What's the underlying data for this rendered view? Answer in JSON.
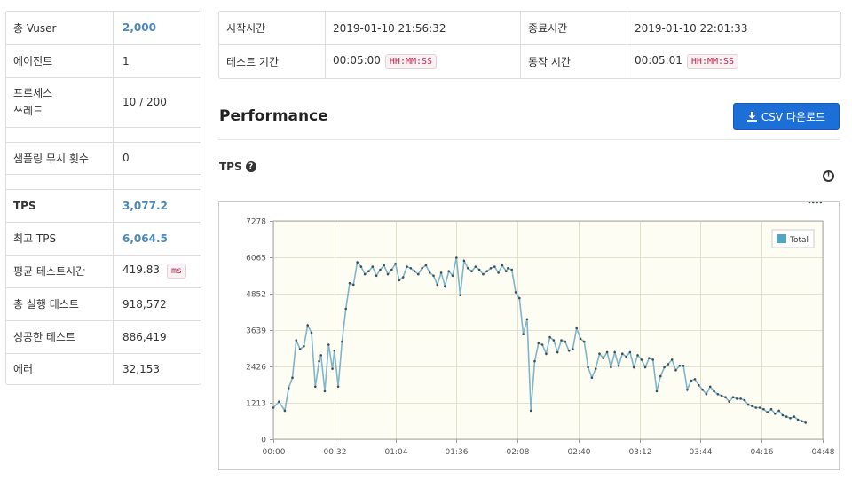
{
  "summary": {
    "rows": [
      {
        "label": "총 Vuser",
        "value": "2,000"
      },
      {
        "label": "에이전트",
        "value": "1"
      },
      {
        "label": "프로세스\n쓰레드",
        "value": "10 / 200"
      },
      {
        "label": "샘플링 무시 횟수",
        "value": "0"
      },
      {
        "label": "TPS",
        "value": "3,077.2"
      },
      {
        "label": "최고 TPS",
        "value": "6,064.5"
      },
      {
        "label": "평균 테스트시간",
        "value": "419.83",
        "unit": "ms"
      },
      {
        "label": "총 실행 테스트",
        "value": "918,572"
      },
      {
        "label": "성공한 테스트",
        "value": "886,419"
      },
      {
        "label": "에러",
        "value": "32,153"
      }
    ]
  },
  "timing": {
    "start_label": "시작시간",
    "start_value": "2019-01-10 21:56:32",
    "end_label": "종료시간",
    "end_value": "2019-01-10 22:01:33",
    "duration_label": "테스트 기간",
    "duration_value": "00:05:00",
    "duration_format": "HH:MM:SS",
    "run_label": "동작 시간",
    "run_value": "00:05:01",
    "run_format": "HH:MM:SS"
  },
  "performance": {
    "title": "Performance",
    "csv_button": "CSV 다운로드",
    "tps_label": "TPS"
  },
  "colors": {
    "accent": "#4c87b9",
    "button": "#1c6fd6",
    "series": "#7fb6c8",
    "plot_bg": "#fefdf3"
  },
  "chart_data": {
    "type": "line",
    "title": "",
    "xlabel": "",
    "ylabel": "",
    "ylim": [
      0,
      7278
    ],
    "y_ticks": [
      "0",
      "1213",
      "2426",
      "3639",
      "4852",
      "6065",
      "7278"
    ],
    "x_ticks": [
      "00:00",
      "00:32",
      "01:04",
      "01:36",
      "02:08",
      "02:40",
      "03:12",
      "03:44",
      "04:16",
      "04:48"
    ],
    "xlim_seconds": [
      0,
      288
    ],
    "legend": "top-right",
    "grid": true,
    "series": [
      {
        "name": "Total",
        "x_seconds": [
          0,
          3,
          6,
          8,
          10,
          12,
          14,
          16,
          18,
          20,
          22,
          24,
          25,
          27,
          29,
          31,
          32,
          34,
          36,
          38,
          40,
          42,
          44,
          46,
          48,
          50,
          52,
          54,
          56,
          58,
          60,
          62,
          64,
          66,
          68,
          70,
          72,
          74,
          76,
          78,
          80,
          82,
          84,
          86,
          88,
          90,
          92,
          94,
          96,
          98,
          100,
          102,
          104,
          106,
          108,
          110,
          112,
          114,
          116,
          118,
          120,
          122,
          123,
          125,
          127,
          129,
          131,
          133,
          135,
          137,
          139,
          141,
          143,
          145,
          147,
          149,
          151,
          153,
          155,
          157,
          159,
          161,
          163,
          165,
          167,
          169,
          171,
          173,
          175,
          177,
          179,
          181,
          183,
          185,
          187,
          189,
          191,
          193,
          195,
          197,
          199,
          201,
          203,
          205,
          207,
          209,
          211,
          213,
          215,
          217,
          219,
          221,
          223,
          225,
          227,
          229,
          231,
          233,
          235,
          237,
          239,
          241,
          243,
          245,
          247,
          249,
          251,
          253,
          255,
          257,
          259,
          261,
          263,
          265,
          267,
          269,
          271,
          273,
          275,
          277,
          279,
          281,
          283,
          285,
          287
        ],
        "values": [
          1050,
          1250,
          950,
          1700,
          2050,
          3300,
          3000,
          3100,
          3800,
          3550,
          1750,
          2600,
          2800,
          1600,
          3150,
          2350,
          2950,
          1750,
          3250,
          4350,
          5200,
          5150,
          5900,
          5750,
          5500,
          5600,
          5750,
          5450,
          5650,
          5800,
          5500,
          5650,
          5850,
          5300,
          5400,
          5750,
          5700,
          5600,
          5500,
          5700,
          5800,
          5550,
          5450,
          5150,
          5550,
          5100,
          5600,
          5450,
          6050,
          4800,
          5950,
          5700,
          5600,
          5750,
          5650,
          5500,
          5600,
          5700,
          5750,
          5550,
          5800,
          5600,
          5700,
          5650,
          4900,
          4700,
          3500,
          4000,
          950,
          2600,
          3200,
          3150,
          2850,
          3400,
          3300,
          2900,
          3300,
          3250,
          2950,
          3000,
          3700,
          3350,
          3250,
          2400,
          2050,
          2350,
          2850,
          2700,
          2900,
          2400,
          2900,
          2450,
          2850,
          2750,
          2900,
          2400,
          2800,
          2650,
          2400,
          2700,
          2650,
          1600,
          2100,
          2400,
          2500,
          2650,
          2300,
          2450,
          2450,
          1650,
          1950,
          2000,
          1800,
          1650,
          1500,
          1750,
          1600,
          1500,
          1450,
          1400,
          1250,
          1400,
          1350,
          1350,
          1300,
          1150,
          1100,
          1050,
          1050,
          1000,
          900,
          1000,
          850,
          950,
          800,
          750,
          700,
          750,
          650,
          600,
          550
        ]
      }
    ]
  }
}
